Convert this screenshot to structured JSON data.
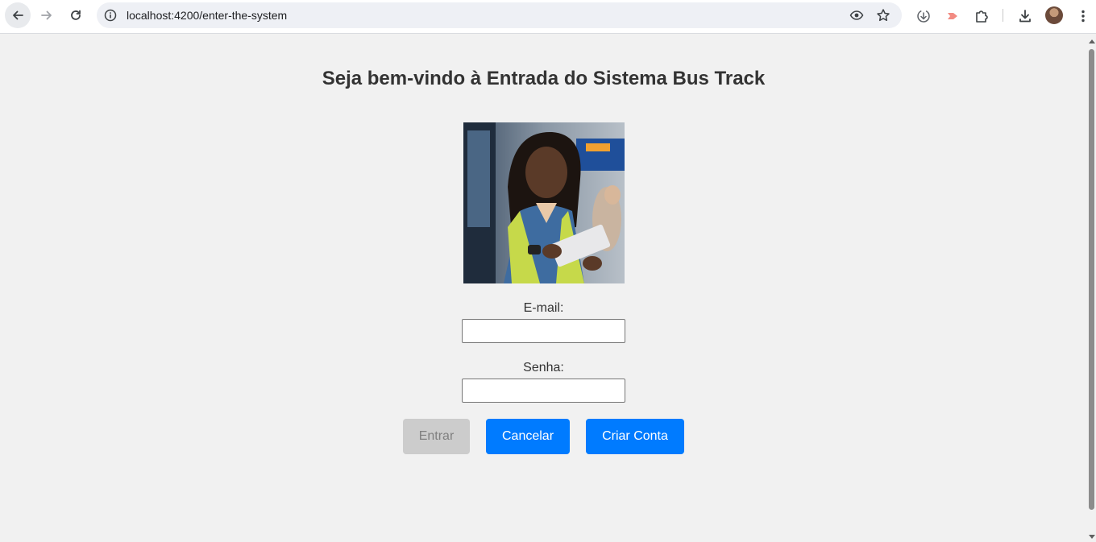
{
  "browser": {
    "url": "localhost:4200/enter-the-system"
  },
  "page": {
    "title": "Seja bem-vindo à Entrada do Sistema Bus Track",
    "email_label": "E-mail:",
    "email_value": "",
    "password_label": "Senha:",
    "password_value": "",
    "buttons": {
      "enter": "Entrar",
      "cancel": "Cancelar",
      "create_account": "Criar Conta"
    }
  },
  "colors": {
    "primary": "#007bff",
    "disabled": "#cccccc",
    "background": "#f1f1f1"
  }
}
